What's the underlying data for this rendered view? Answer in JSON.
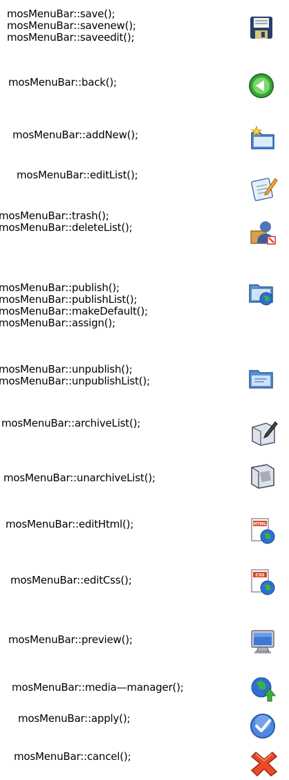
{
  "entries": [
    {
      "lines": [
        "mosMenuBar::save();",
        "mosMenuBar::savenew();",
        "mosMenuBar::saveedit();"
      ],
      "icon": "save-disk-icon"
    },
    {
      "lines": [
        "mosMenuBar::back();"
      ],
      "icon": "back-arrow-icon"
    },
    {
      "lines": [
        "mosMenuBar::addNew();"
      ],
      "icon": "new-folder-star-icon"
    },
    {
      "lines": [
        "mosMenuBar::editList();"
      ],
      "icon": "edit-pencil-icon"
    },
    {
      "lines": [
        "mosMenuBar::trash();",
        "mosMenuBar::deleteList();"
      ],
      "icon": "trash-user-icon"
    },
    {
      "lines": [
        "mosMenuBar::publish();",
        "mosMenuBar::publishList();",
        "mosMenuBar::makeDefault();",
        "mosMenuBar::assign();"
      ],
      "icon": "publish-globe-icon"
    },
    {
      "lines": [
        "mosMenuBar::unpublish();",
        "mosMenuBar::unpublishList();"
      ],
      "icon": "unpublish-folder-icon"
    },
    {
      "lines": [
        "mosMenuBar::archiveList();"
      ],
      "icon": "archive-icon"
    },
    {
      "lines": [
        "mosMenuBar::unarchiveList();"
      ],
      "icon": "unarchive-icon"
    },
    {
      "lines": [
        "mosMenuBar::editHtml();"
      ],
      "icon": "edit-html-icon"
    },
    {
      "lines": [
        "mosMenuBar::editCss();"
      ],
      "icon": "edit-css-icon"
    },
    {
      "lines": [
        "mosMenuBar::preview();"
      ],
      "icon": "preview-monitor-icon"
    },
    {
      "lines": [
        "mosMenuBar::media—manager();"
      ],
      "icon": "media-manager-icon"
    },
    {
      "lines": [
        "mosMenuBar::apply();"
      ],
      "icon": "apply-check-icon"
    },
    {
      "lines": [
        "mosMenuBar::cancel();"
      ],
      "icon": "cancel-x-icon"
    }
  ],
  "icon_texts": {
    "html": "HTML",
    "css": "CSS"
  }
}
